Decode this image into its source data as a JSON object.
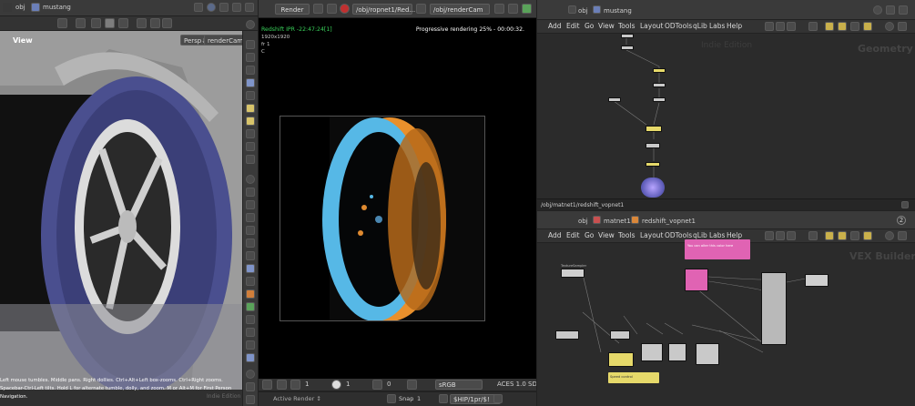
{
  "left_pane": {
    "path_obj": "obj",
    "path_asset": "mustang",
    "view_label": "View",
    "persp_label": "Persp↓",
    "camera_label": "renderCam↓",
    "status_text": "Left mouse tumbles. Middle pans. Right dollies. Ctrl+Alt+Left box-zooms. Ctrl+Right zooms.\nSpacebar-Ctrl-Left tilts. Hold L for alternate tumble, dolly, and zoom. M or Alt+M for First Person\nNavigation.",
    "indie_text": "Indie Edition"
  },
  "render_view": {
    "render_button": "Render",
    "rop_path": "/obj/ropnet1/Red...",
    "cam_path": "/obj/renderCam",
    "ipr_title": "Redshift IPR -22:47:24[1]",
    "resolution": "1920x1920",
    "frame_line": "fr 1",
    "c_line": "C",
    "progress_text": "Progressive rendering 25% - 00:00:32.",
    "zoom_value": "1",
    "frame_value": "1",
    "frame_value2": "0",
    "colorspace": "sRGB",
    "ocio": "ACES 1.0 SD",
    "snap_label": "Snap",
    "snap_value": "1",
    "job_path": "$HIP/1pr/$!",
    "active_render_label": "Active Render ↕"
  },
  "network_top": {
    "path_obj": "obj",
    "path_asset": "mustang",
    "menu": [
      "Add",
      "Edit",
      "Go",
      "View",
      "Tools",
      "Layout",
      "ODTools",
      "qLib",
      "Labs",
      "Help"
    ],
    "watermark_edition": "Indie Edition",
    "watermark_context": "Geometry"
  },
  "network_bottom": {
    "tab_label": "/obj/matnet1/redshift_vopnet1",
    "path_obj": "obj",
    "path_matnet": "matnet1",
    "path_vopnet": "redshift_vopnet1",
    "menu": [
      "Add",
      "Edit",
      "Go",
      "View",
      "Tools",
      "Layout",
      "ODTools",
      "qLib",
      "Labs",
      "Help"
    ],
    "sticky_text": "You can alter this color here",
    "sticky_bottom": "Speed control",
    "watermark_context": "VEX Builder",
    "zoom_badge": "2"
  },
  "colors": {
    "accent_orange": "#e8a23a",
    "sticky_pink": "#e063b3",
    "sticky_yellow": "#e6d96a",
    "ipr_green": "#39d15a"
  }
}
